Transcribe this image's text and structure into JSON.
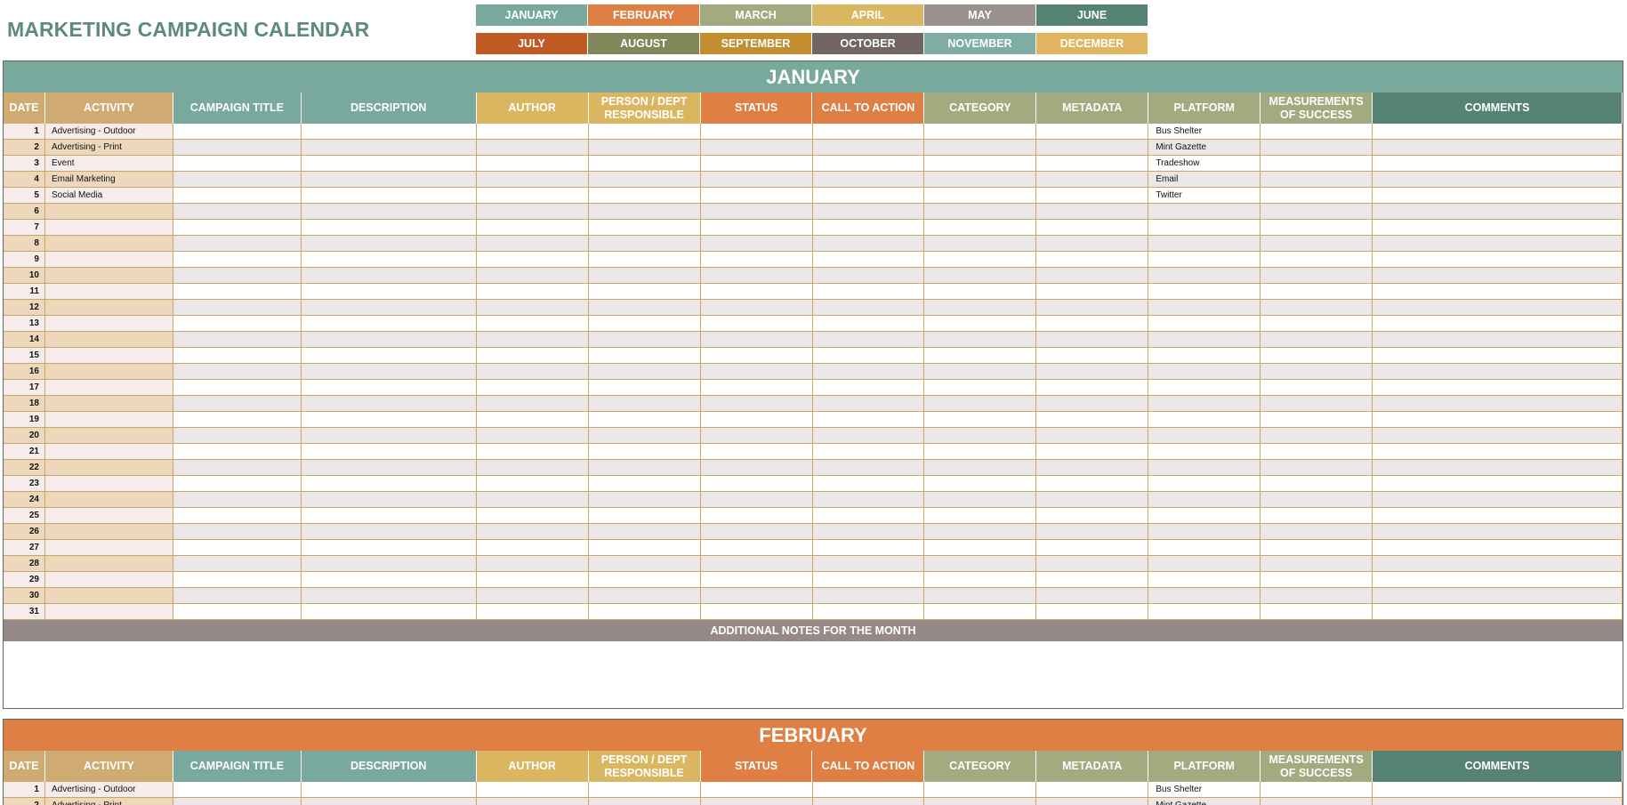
{
  "title": "MARKETING CAMPAIGN CALENDAR",
  "months_nav": [
    {
      "label": "JANUARY",
      "color": "#79a89d"
    },
    {
      "label": "FEBRUARY",
      "color": "#e07f44"
    },
    {
      "label": "MARCH",
      "color": "#a2aa7f"
    },
    {
      "label": "APRIL",
      "color": "#dbb660"
    },
    {
      "label": "MAY",
      "color": "#9a908d"
    },
    {
      "label": "JUNE",
      "color": "#558273"
    },
    {
      "label": "JULY",
      "color": "#bf5a25"
    },
    {
      "label": "AUGUST",
      "color": "#82875b"
    },
    {
      "label": "SEPTEMBER",
      "color": "#c28e2f"
    },
    {
      "label": "OCTOBER",
      "color": "#716664"
    },
    {
      "label": "NOVEMBER",
      "color": "#7fada3"
    },
    {
      "label": "DECEMBER",
      "color": "#dfb560"
    }
  ],
  "columns": [
    {
      "label": "DATE",
      "color": "#cfab72"
    },
    {
      "label": "ACTIVITY",
      "color": "#cfab72"
    },
    {
      "label": "CAMPAIGN TITLE",
      "color": "#79a89d"
    },
    {
      "label": "DESCRIPTION",
      "color": "#79a89d"
    },
    {
      "label": "AUTHOR",
      "color": "#dbb660"
    },
    {
      "label": "PERSON / DEPT RESPONSIBLE",
      "color": "#dbb660"
    },
    {
      "label": "STATUS",
      "color": "#e07f44"
    },
    {
      "label": "CALL TO ACTION",
      "color": "#e07f44"
    },
    {
      "label": "CATEGORY",
      "color": "#a2aa7f"
    },
    {
      "label": "METADATA",
      "color": "#a2aa7f"
    },
    {
      "label": "PLATFORM",
      "color": "#a2aa7f"
    },
    {
      "label": "MEASUREMENTS OF SUCCESS",
      "color": "#a2aa7f"
    },
    {
      "label": "COMMENTS",
      "color": "#558273"
    }
  ],
  "sample_rows": [
    {
      "activity": "Advertising - Outdoor",
      "platform": "Bus Shelter"
    },
    {
      "activity": "Advertising - Print",
      "platform": "Mint Gazette"
    },
    {
      "activity": "Event",
      "platform": "Tradeshow"
    },
    {
      "activity": "Email Marketing",
      "platform": "Email"
    },
    {
      "activity": "Social Media",
      "platform": "Twitter"
    }
  ],
  "sections": [
    {
      "month": "JANUARY",
      "color": "#79a89d",
      "rows_shown": 31,
      "notes_label": "ADDITIONAL NOTES FOR THE MONTH",
      "has_notes": true
    },
    {
      "month": "FEBRUARY",
      "color": "#e07f44",
      "rows_shown": 2,
      "has_notes": false
    }
  ],
  "row_colors": {
    "date_odd": "#f7ecec",
    "date_even": "#edd8bb",
    "cell_odd": "#ffffff",
    "cell_even": "#ebe7e8",
    "grid": "#c9a56b"
  }
}
